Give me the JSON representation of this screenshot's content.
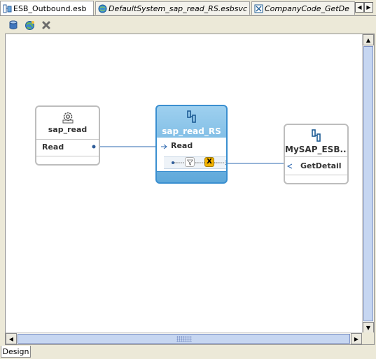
{
  "tabs": [
    {
      "label": "ESB_Outbound.esb",
      "icon": "esb-system-icon",
      "active": true
    },
    {
      "label": "DefaultSystem_sap_read_RS.esbsvc",
      "icon": "globe-service-icon",
      "active": false
    },
    {
      "label": "CompanyCode_GetDe",
      "icon": "adapter-service-icon",
      "active": false
    }
  ],
  "toolbar": {
    "buttons": [
      {
        "name": "database-icon"
      },
      {
        "name": "globe-icon"
      },
      {
        "name": "delete-x-icon"
      }
    ]
  },
  "diagram": {
    "nodes": [
      {
        "title": "sap_read",
        "operation": "Read",
        "icon": "gear-service-icon"
      },
      {
        "title": "sap_read_RS",
        "operation": "Read",
        "icon": "routing-service-icon",
        "filter_label": "X"
      },
      {
        "title": "MySAP_ESB...",
        "operation": "GetDetail",
        "icon": "routing-service-icon"
      }
    ]
  },
  "bottom_tabs": [
    {
      "label": "Design"
    }
  ],
  "colors": {
    "selected_node_top": "#9ed0ef",
    "selected_node_bottom": "#5ea8da",
    "connector": "#2e68b0",
    "transform_badge": "#f2b200"
  }
}
